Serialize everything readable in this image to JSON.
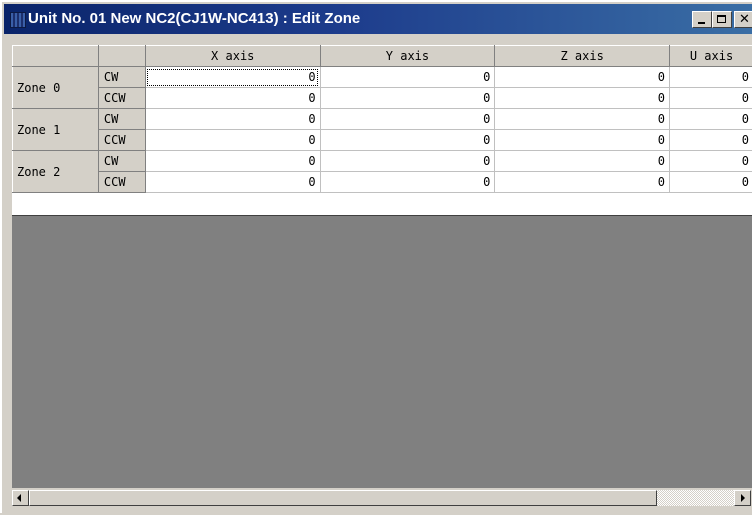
{
  "window": {
    "title": "Unit No. 01 New NC2(CJ1W-NC413) : Edit Zone",
    "titlebar_color": "#0a246a",
    "controls": [
      "minimize-icon",
      "maximize-icon",
      "close-icon"
    ]
  },
  "grid": {
    "headers": [
      "",
      "",
      "X axis",
      "Y axis",
      "Z axis",
      "U axis"
    ],
    "zones": [
      {
        "label": "Zone 0",
        "rows": [
          {
            "dir": "CW",
            "values": [
              "0",
              "0",
              "0",
              "0"
            ]
          },
          {
            "dir": "CCW",
            "values": [
              "0",
              "0",
              "0",
              "0"
            ]
          }
        ]
      },
      {
        "label": "Zone 1",
        "rows": [
          {
            "dir": "CW",
            "values": [
              "0",
              "0",
              "0",
              "0"
            ]
          },
          {
            "dir": "CCW",
            "values": [
              "0",
              "0",
              "0",
              "0"
            ]
          }
        ]
      },
      {
        "label": "Zone 2",
        "rows": [
          {
            "dir": "CW",
            "values": [
              "0",
              "0",
              "0",
              "0"
            ]
          },
          {
            "dir": "CCW",
            "values": [
              "0",
              "0",
              "0",
              "0"
            ]
          }
        ]
      }
    ]
  }
}
